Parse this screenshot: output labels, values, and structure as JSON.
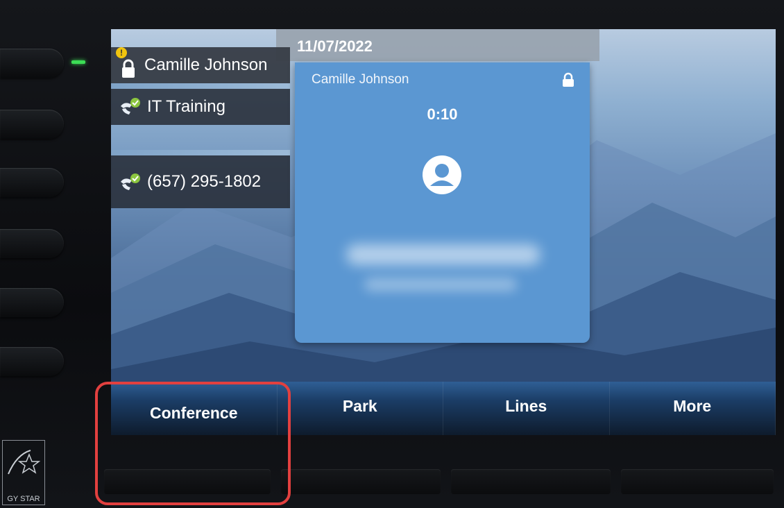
{
  "status_bar": {
    "date": "11/07/2022"
  },
  "lines": [
    {
      "label": "Camille Johnson",
      "icon": "lock-icon",
      "alert": "!",
      "active": true
    },
    {
      "label": "IT Training",
      "icon": "phone-check-icon",
      "active": false
    },
    {
      "label": "(657) 295-1802",
      "icon": "phone-check-icon",
      "active": false
    }
  ],
  "call_card": {
    "caller": "Camille Johnson",
    "timer": "0:10",
    "avatar_icon": "user-avatar-icon",
    "lock_icon": "lock-icon"
  },
  "softkeys": [
    "Conference",
    "Park",
    "Lines",
    "More"
  ],
  "highlight_color": "#e2403f",
  "energy_label": "GY STAR",
  "colors": {
    "card": "#5b97d2",
    "led": "#3cdc55"
  }
}
